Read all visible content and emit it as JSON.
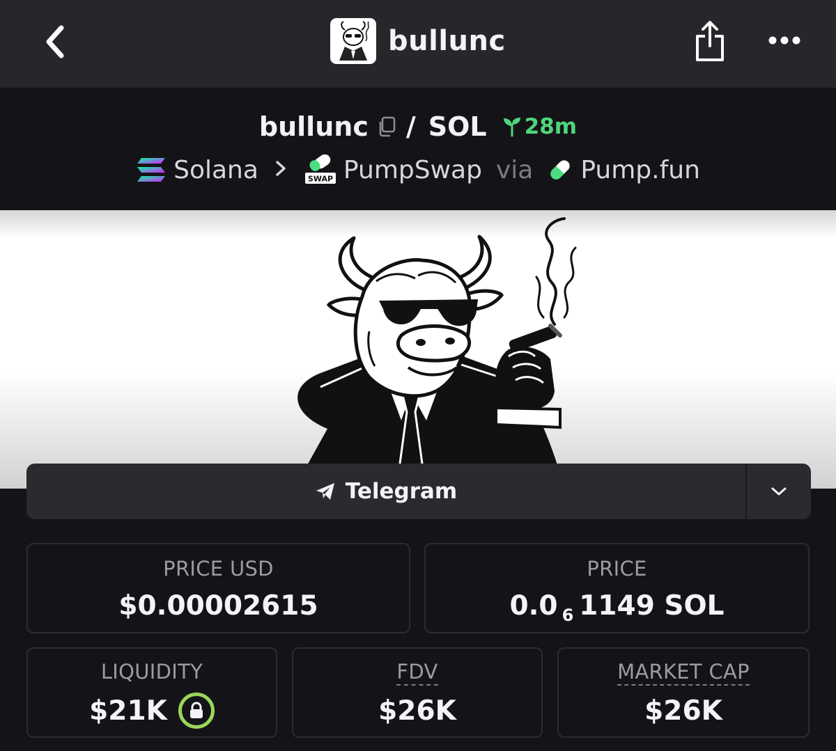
{
  "header": {
    "title": "bullunc",
    "back_icon": "chevron-left-icon",
    "share_icon": "share-icon",
    "more_icon": "more-dots-icon"
  },
  "pair": {
    "base": "bullunc",
    "separator": "/",
    "quote": "SOL",
    "age": "28m",
    "age_color": "#4fd67a"
  },
  "chain": {
    "network": "Solana",
    "dex": "PumpSwap",
    "via": "via",
    "launchpad": "Pump.fun",
    "dex_badge": "SWAP"
  },
  "links": {
    "telegram_label": "Telegram"
  },
  "stats": {
    "price_usd_label": "PRICE USD",
    "price_usd_value": "$0.00002615",
    "price_label": "PRICE",
    "price_prefix": "0.0",
    "price_zero_count": "6",
    "price_digits": "1149 SOL",
    "liquidity_label": "LIQUIDITY",
    "liquidity_value": "$21K",
    "fdv_label": "FDV",
    "fdv_value": "$26K",
    "mcap_label": "MARKET CAP",
    "mcap_value": "$26K",
    "lock_color": "#9bd65a"
  }
}
